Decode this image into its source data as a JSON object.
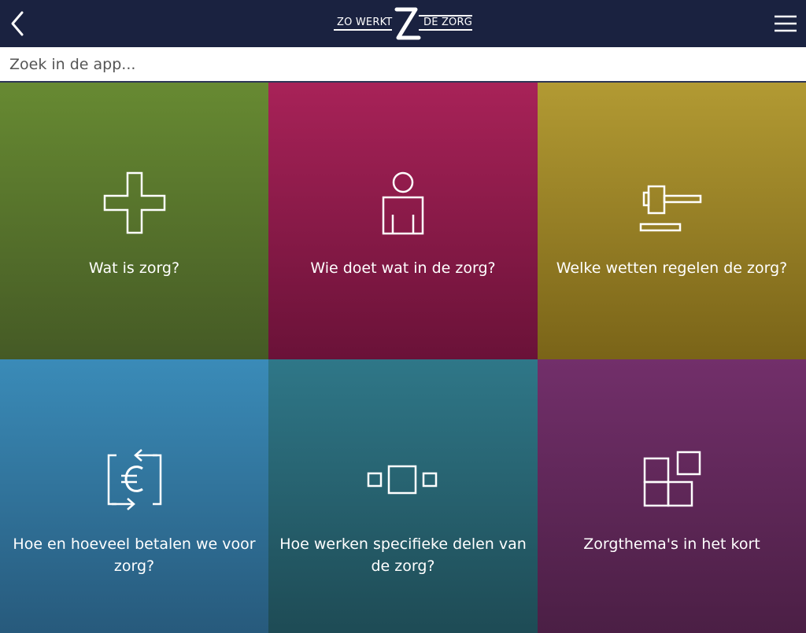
{
  "header": {
    "logo_left": "ZO WERKT",
    "logo_right": "DE ZORG",
    "back_icon": "chevron-left-icon",
    "menu_icon": "hamburger-menu-icon"
  },
  "search": {
    "placeholder": "Zoek in de app..."
  },
  "tiles": [
    {
      "label": "Wat is zorg?",
      "icon": "plus-cross-icon",
      "color": "#5f8130"
    },
    {
      "label": "Wie doet wat in de zorg?",
      "icon": "person-icon",
      "color": "#951d4d"
    },
    {
      "label": "Welke wetten regelen de zorg?",
      "icon": "gavel-icon",
      "color": "#9c852a"
    },
    {
      "label": "Hoe en hoeveel betalen we voor zorg?",
      "icon": "euro-exchange-icon",
      "color": "#337ba6"
    },
    {
      "label": "Hoe werken specifieke delen van de zorg?",
      "icon": "squares-row-icon",
      "color": "#2a6674"
    },
    {
      "label": "Zorgthema's in het kort",
      "icon": "stacked-squares-icon",
      "color": "#652a5e"
    }
  ]
}
